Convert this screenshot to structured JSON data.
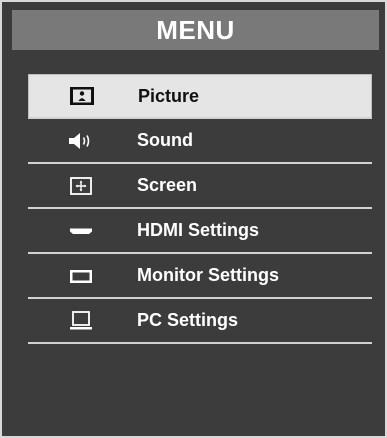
{
  "header": {
    "title": "MENU"
  },
  "colors": {
    "frame_bg": "#3c3c3c",
    "header_bg": "#797979",
    "selected_bg": "#e5e5e5",
    "divider": "#d2d2d2"
  },
  "menu": {
    "items": [
      {
        "label": "Picture",
        "icon": "picture-icon",
        "selected": true
      },
      {
        "label": "Sound",
        "icon": "speaker-icon",
        "selected": false
      },
      {
        "label": "Screen",
        "icon": "screen-resize-icon",
        "selected": false
      },
      {
        "label": "HDMI Settings",
        "icon": "hdmi-port-icon",
        "selected": false
      },
      {
        "label": "Monitor Settings",
        "icon": "monitor-icon",
        "selected": false
      },
      {
        "label": "PC Settings",
        "icon": "pc-icon",
        "selected": false
      }
    ]
  }
}
